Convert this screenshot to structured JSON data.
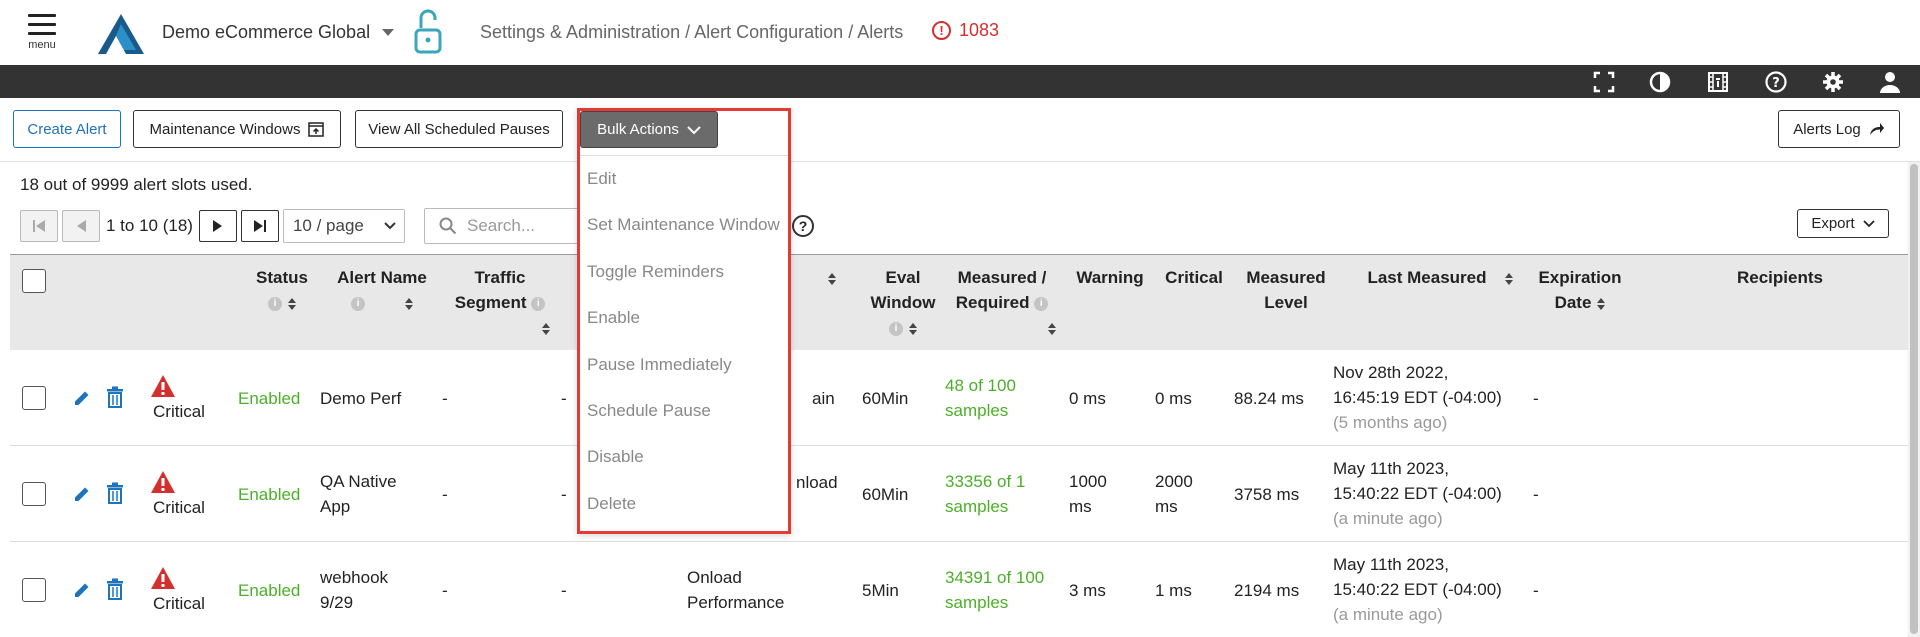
{
  "header": {
    "menu_label": "menu",
    "org_name": "Demo eCommerce Global",
    "breadcrumb": "Settings & Administration / Alert Configuration / Alerts",
    "alert_count": "1083"
  },
  "toolbar": {
    "create_alert": "Create Alert",
    "maintenance_windows": "Maintenance Windows",
    "view_scheduled_pauses": "View All Scheduled Pauses",
    "bulk_actions": "Bulk Actions",
    "alerts_log": "Alerts Log"
  },
  "bulk_menu": {
    "items": [
      "Edit",
      "Set Maintenance Window",
      "Toggle Reminders",
      "Enable",
      "Pause Immediately",
      "Schedule Pause",
      "Disable",
      "Delete"
    ]
  },
  "summary": "18 out of 9999 alert slots used.",
  "pager": {
    "range": "1 to 10 (18)",
    "page_size": "10 / page",
    "search_placeholder": "Search..."
  },
  "export_label": "Export",
  "table": {
    "columns": {
      "status": "Status",
      "alert_name": "Alert Name",
      "traffic_1": "Traffic",
      "traffic_2": "Segment",
      "eval_1": "Eval",
      "eval_2": "Window",
      "measured_1": "Measured /",
      "measured_2": "Required",
      "warning": "Warning",
      "critical": "Critical",
      "level_1": "Measured",
      "level_2": "Level",
      "last_measured": "Last Measured",
      "exp_1": "Expiration",
      "exp_2": "Date",
      "recipients": "Recipients"
    },
    "rows": [
      {
        "severity": "Critical",
        "status": "Enabled",
        "name_1": "Demo Perf",
        "name_2": "",
        "traffic": "-",
        "col2": "-",
        "metric_1": "ain",
        "metric_2": "",
        "eval": "60Min",
        "measured_1": "48 of 100",
        "measured_2": "samples",
        "warning_1": "0 ms",
        "warning_2": "",
        "critical_1": "0 ms",
        "critical_2": "",
        "level": "88.24 ms",
        "last_1": "Nov 28th 2022,",
        "last_2": "16:45:19 EDT (-04:00)",
        "last_3": "(5 months ago)",
        "expiration": "-"
      },
      {
        "severity": "Critical",
        "status": "Enabled",
        "name_1": "QA Native",
        "name_2": "App",
        "traffic": "-",
        "col2": "-",
        "metric_1": "nload",
        "metric_2": "",
        "eval": "60Min",
        "measured_1": "33356 of 1",
        "measured_2": "samples",
        "warning_1": "1000",
        "warning_2": "ms",
        "critical_1": "2000",
        "critical_2": "ms",
        "level": "3758 ms",
        "last_1": "May 11th 2023,",
        "last_2": "15:40:22 EDT (-04:00)",
        "last_3": "(a minute ago)",
        "expiration": "-"
      },
      {
        "severity": "Critical",
        "status": "Enabled",
        "name_1": "webhook",
        "name_2": "9/29",
        "traffic": "-",
        "col2": "-",
        "metric_1": "Onload",
        "metric_2": "Performance",
        "eval": "5Min",
        "measured_1": "34391 of 100",
        "measured_2": "samples",
        "warning_1": "3 ms",
        "warning_2": "",
        "critical_1": "1 ms",
        "critical_2": "",
        "level": "2194 ms",
        "last_1": "May 11th 2023,",
        "last_2": "15:40:22 EDT (-04:00)",
        "last_3": "(a minute ago)",
        "expiration": "-"
      }
    ]
  },
  "colors": {
    "accent_blue": "#1e73be",
    "enabled_green": "#4caf2a",
    "critical_red": "#d32f2f",
    "highlight_border": "#e53935"
  }
}
